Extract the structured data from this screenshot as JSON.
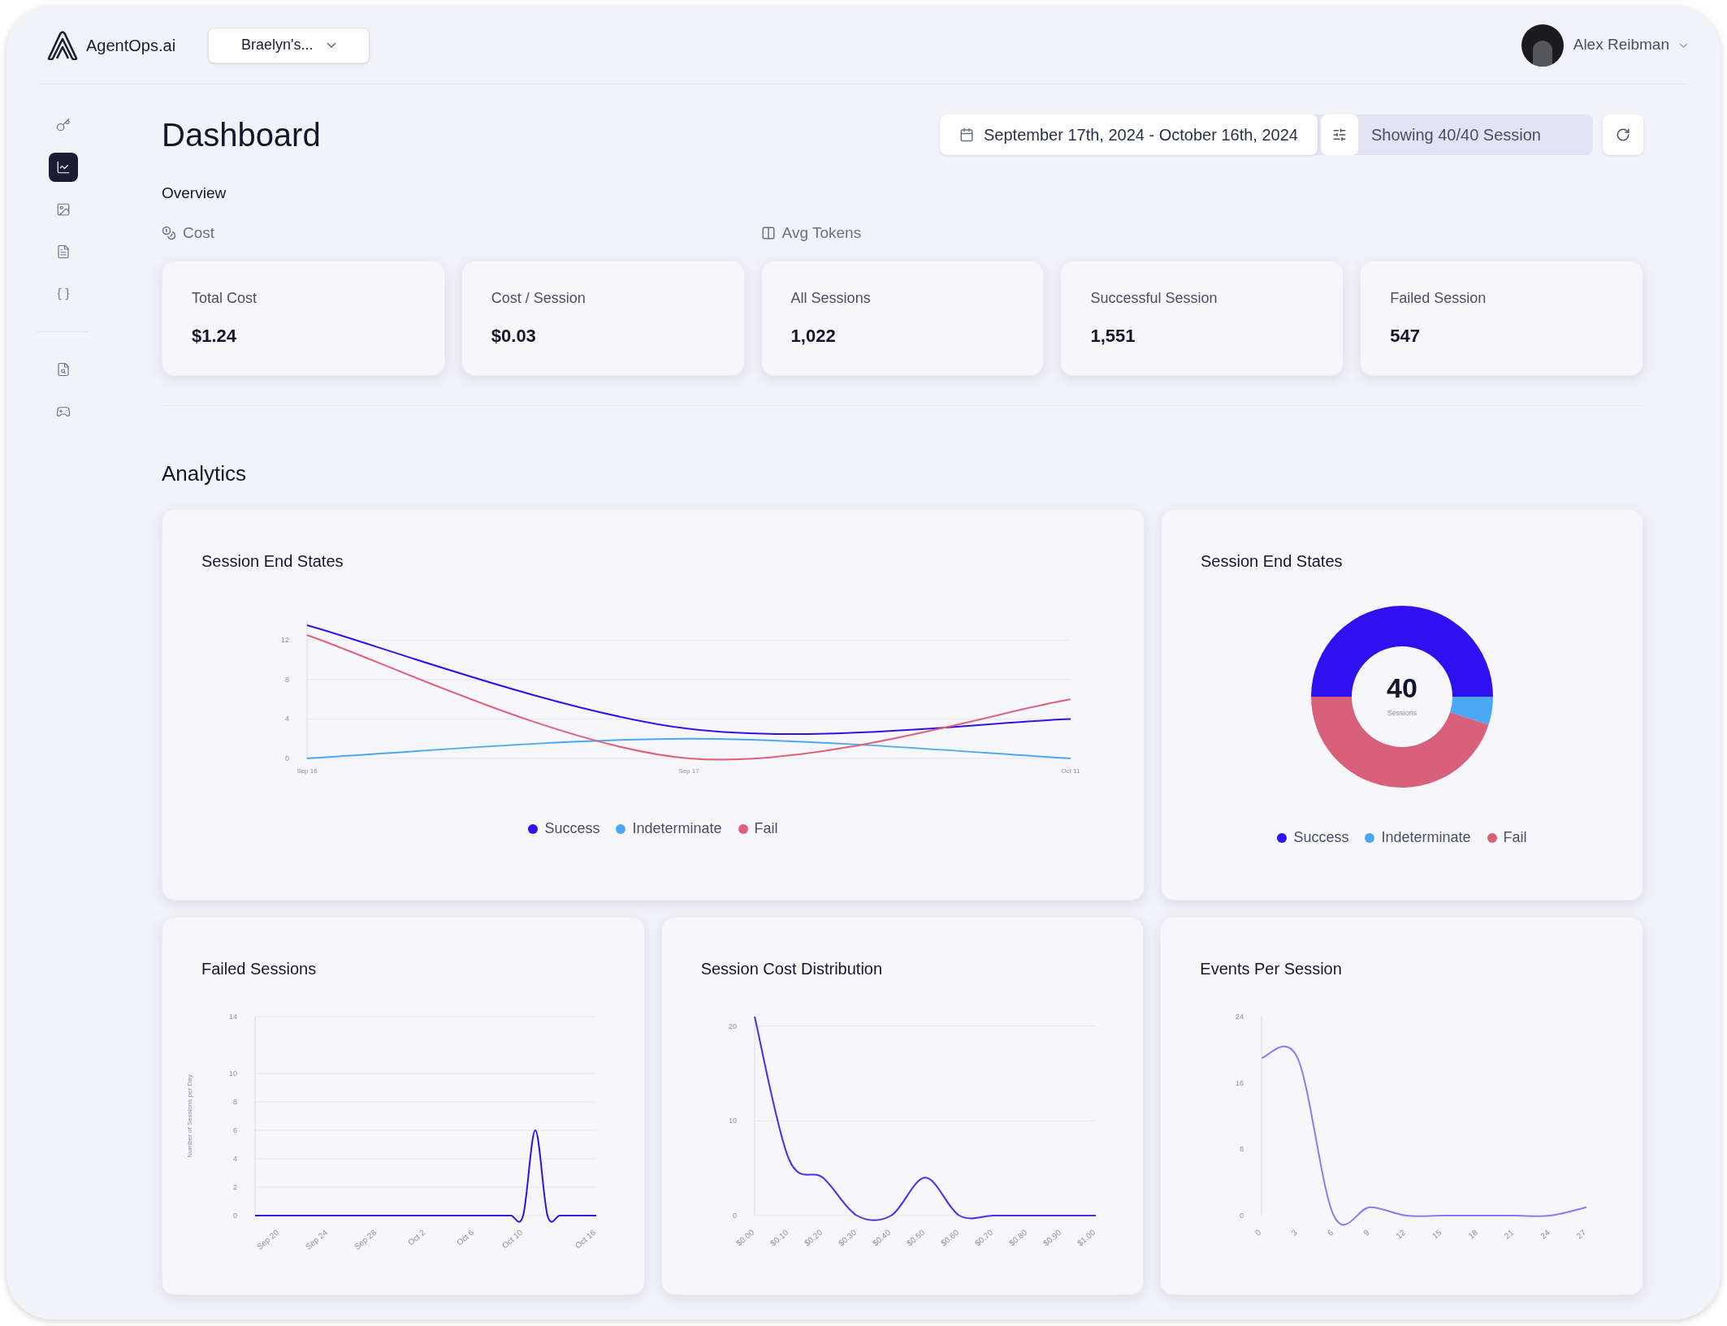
{
  "header": {
    "brand": "AgentOps.ai",
    "project": "Braelyn's...",
    "user": "Alex Reibman"
  },
  "sidebar": {
    "top_items": [
      {
        "selected": false
      },
      {
        "selected": true
      },
      {
        "selected": false
      },
      {
        "selected": false
      },
      {
        "selected": false
      }
    ],
    "bottom_items": [
      {
        "selected": false
      },
      {
        "selected": false
      }
    ]
  },
  "page": {
    "title": "Dashboard",
    "date_range": "September 17th, 2024 - October 16th, 2024",
    "session_count": "Showing 40/40 Session"
  },
  "overview": {
    "title": "Overview",
    "groups": [
      {
        "label": "Cost",
        "kind": "coins"
      },
      {
        "label": "Avg Tokens",
        "kind": "tokens"
      }
    ],
    "stats": [
      {
        "label": "Total Cost",
        "value": "$1.24"
      },
      {
        "label": "Cost / Session",
        "value": "$0.03"
      },
      {
        "label": "All Sessions",
        "value": "1,022"
      },
      {
        "label": "Successful Session",
        "value": "1,551"
      },
      {
        "label": "Failed Session",
        "value": "547"
      }
    ]
  },
  "analytics": {
    "title": "Analytics",
    "end_states_line": {
      "title": "Session End States",
      "chart_data": {
        "type": "line",
        "grid": true,
        "categories": [
          "Sep 16",
          "Sep 17",
          "Oct 11"
        ],
        "ylim": [
          0,
          14
        ],
        "yticks": [
          0,
          4,
          8,
          12
        ],
        "series": [
          {
            "name": "Success",
            "color": "#2e10f0",
            "values": [
              13.5,
              3,
              4
            ]
          },
          {
            "name": "Indeterminate",
            "color": "#4aa8f5",
            "values": [
              0,
              2,
              0
            ]
          },
          {
            "name": "Fail",
            "color": "#e0607a",
            "values": [
              12.5,
              0,
              6
            ]
          }
        ]
      }
    },
    "end_states_donut": {
      "title": "Session End States",
      "center_value": "40",
      "center_label": "Sessions",
      "chart_data": {
        "type": "donut",
        "categories": [
          "Success",
          "Indeterminate",
          "Fail"
        ],
        "values": [
          50,
          5,
          45
        ],
        "colors": [
          "#2e10f0",
          "#4aa8f5",
          "#d9607a"
        ]
      }
    },
    "failed_sessions": {
      "title": "Failed Sessions",
      "chart_data": {
        "type": "line",
        "grid": true,
        "ylabel": "Number of Sessions per Day",
        "categories": [
          null,
          null,
          "Sep 20",
          null,
          null,
          null,
          "Sep 24",
          null,
          null,
          null,
          "Sep 28",
          null,
          null,
          null,
          "Oct 2",
          null,
          null,
          null,
          "Oct 6",
          null,
          null,
          null,
          "Oct 10",
          null,
          null,
          null,
          null,
          null,
          "Oct 16"
        ],
        "ylim": [
          0,
          14
        ],
        "yticks": [
          0,
          2,
          4,
          6,
          8,
          10,
          14
        ],
        "series": [
          {
            "color": "#2e10f0",
            "values": [
              0,
              0,
              0,
              0,
              0,
              0,
              0,
              0,
              0,
              0,
              0,
              0,
              0,
              0,
              0,
              0,
              0,
              0,
              0,
              0,
              0,
              0,
              0,
              6,
              0,
              0,
              0,
              0,
              0
            ]
          }
        ]
      }
    },
    "cost_distribution": {
      "title": "Session Cost Distribution",
      "chart_data": {
        "type": "line",
        "grid": true,
        "x": [
          0,
          0.1,
          0.2,
          0.3,
          0.4,
          0.5,
          0.6,
          0.7,
          0.8,
          0.9,
          1
        ],
        "xticks": [
          {
            "value": 0,
            "label": "$0.00"
          },
          {
            "value": 0.1,
            "label": "$0.10"
          },
          {
            "value": 0.2,
            "label": "$0.20"
          },
          {
            "value": 0.3,
            "label": "$0.30"
          },
          {
            "value": 0.4,
            "label": "$0.40"
          },
          {
            "value": 0.5,
            "label": "$0.50"
          },
          {
            "value": 0.6,
            "label": "$0.60"
          },
          {
            "value": 0.7,
            "label": "$0.70"
          },
          {
            "value": 0.8,
            "label": "$0.80"
          },
          {
            "value": 0.9,
            "label": "$0.90"
          },
          {
            "value": 1,
            "label": "$1.00"
          }
        ],
        "xlim": [
          0,
          1
        ],
        "ylim": [
          0,
          21
        ],
        "yticks": [
          0,
          10,
          20
        ],
        "series": [
          {
            "color": "#4a2cf5",
            "values": [
              21,
              6,
              4,
              0,
              0,
              4,
              0,
              0,
              0,
              0,
              0
            ]
          }
        ]
      }
    },
    "events_per_session": {
      "title": "Events Per Session",
      "chart_data": {
        "type": "line",
        "grid": false,
        "x": [
          0,
          3,
          6,
          9,
          12,
          15,
          18,
          21,
          24,
          27
        ],
        "xticks": [
          0,
          3,
          6,
          9,
          12,
          15,
          18,
          21,
          24,
          27
        ],
        "xlim": [
          0,
          27
        ],
        "ylim": [
          0,
          24
        ],
        "yticks": [
          0,
          8,
          16,
          24
        ],
        "series": [
          {
            "color": "#8a7cf8",
            "values": [
              19,
              19,
              0,
              1,
              0,
              0,
              0,
              0,
              0,
              1
            ]
          }
        ]
      }
    }
  }
}
